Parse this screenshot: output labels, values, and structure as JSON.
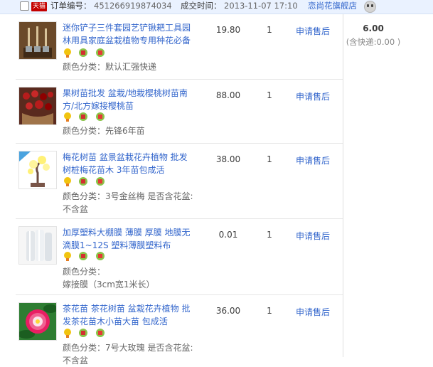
{
  "order": {
    "platform_badge": "天猫",
    "order_no_label": "订单编号：",
    "order_no": "451266919874034",
    "time_label": "成交时间：",
    "time": "2013-11-07 17:10",
    "shop_name": "恋尚花旗舰店"
  },
  "summary": {
    "total": "6.00",
    "shipping_note": "(含快递:0.00 )"
  },
  "items": [
    {
      "title": "迷你铲子三件套园艺铲锹耙工具园林用具家庭盆栽植物专用种花必备",
      "attr_label": "颜色分类：",
      "attr_value": "默认汇强快递",
      "price": "19.80",
      "qty": "1",
      "action": "申请售后"
    },
    {
      "title": "果树苗批发 盆栽/地栽樱桃树苗南方/北方嫁接樱桃苗",
      "attr_label": "颜色分类：",
      "attr_value": "先锋6年苗",
      "price": "88.00",
      "qty": "1",
      "action": "申请售后"
    },
    {
      "title": "梅花树苗 盆景盆栽花卉植物 批发树桩梅花苗木 3年苗包成活",
      "attr_label": "颜色分类：",
      "attr_value": "3号金丝梅 是否含花盆:不含盆",
      "price": "38.00",
      "qty": "1",
      "action": "申请售后"
    },
    {
      "title": "加厚塑料大棚膜 薄膜 厚膜 地膜无滴膜1~12S 塑料薄膜塑料布",
      "attr_label": "颜色分类：",
      "attr_value": "嫁接膜（3cm宽1米长）",
      "price": "0.01",
      "qty": "1",
      "action": "申请售后"
    },
    {
      "title": "茶花苗 茶花树苗 盆栽花卉植物 批发茶花苗木小苗大苗 包成活",
      "attr_label": "颜色分类：",
      "attr_value": "7号大玫瑰 是否含花盆:不含盆",
      "price": "36.00",
      "qty": "1",
      "action": "申请售后"
    }
  ],
  "tag_icons": [
    "medal-icon",
    "authentic-icon",
    "promo-icon"
  ],
  "colors": {
    "header_bg": "#eaf2ff",
    "link": "#3366cc",
    "tmall_red": "#c40000"
  }
}
